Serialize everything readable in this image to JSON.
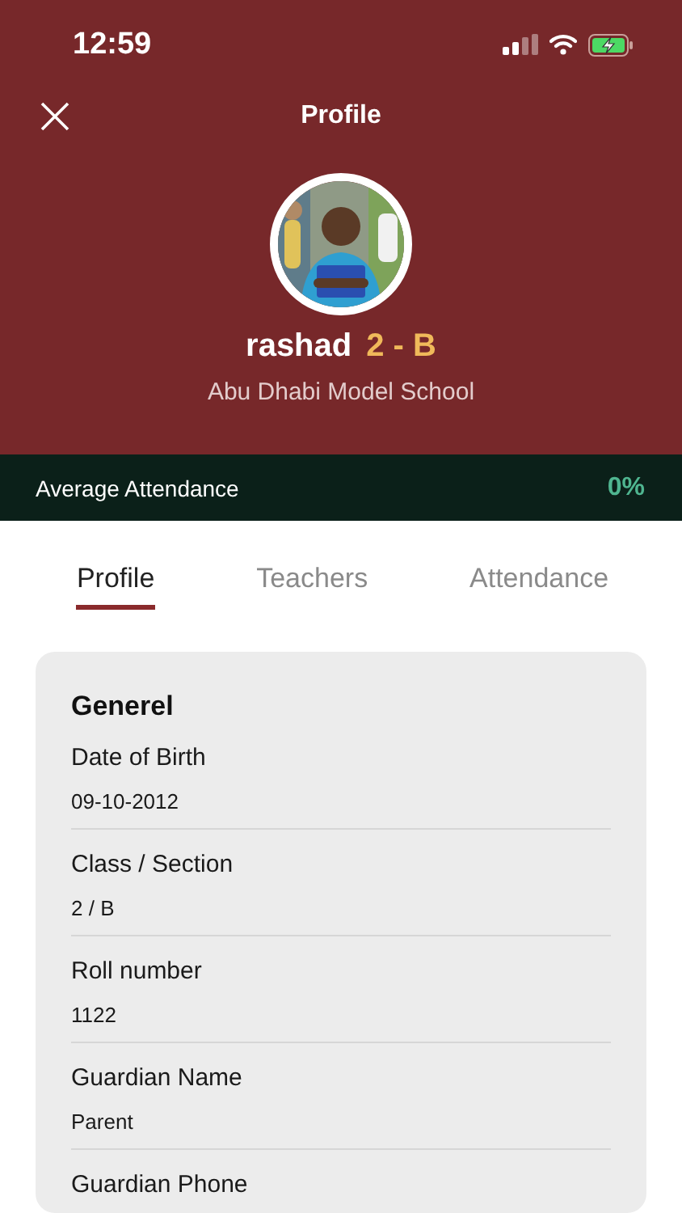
{
  "status_bar": {
    "time": "12:59",
    "battery_charging": true
  },
  "header": {
    "title": "Profile"
  },
  "profile": {
    "name": "rashad",
    "class_section": "2 - B",
    "school": "Abu Dhabi Model School"
  },
  "attendance_bar": {
    "label": "Average Attendance",
    "value": "0%"
  },
  "tabs": [
    {
      "label": "Profile",
      "selected": true
    },
    {
      "label": "Teachers",
      "selected": false
    },
    {
      "label": "Attendance",
      "selected": false
    }
  ],
  "section": {
    "title": "Generel",
    "fields": [
      {
        "label": "Date of Birth",
        "value": "09-10-2012"
      },
      {
        "label": "Class / Section",
        "value": "2 / B"
      },
      {
        "label": "Roll number",
        "value": "1122"
      },
      {
        "label": "Guardian Name",
        "value": "Parent"
      },
      {
        "label": "Guardian Phone"
      }
    ]
  }
}
